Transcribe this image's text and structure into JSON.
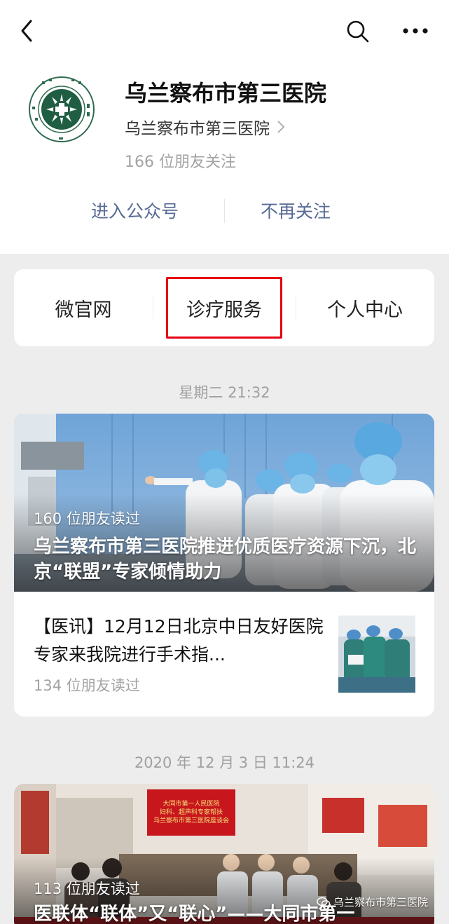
{
  "icons": {
    "back": "chevron-left-icon",
    "search": "search-icon",
    "more": "more-dots-icon",
    "chevron": "chevron-right-icon",
    "wechat": "wechat-icon"
  },
  "account": {
    "name": "乌兰察布市第三医院",
    "subject": "乌兰察布市第三医院",
    "followers": "166 位朋友关注",
    "logo_text_top": "乌兰察布市",
    "logo_text_side": "第三医院"
  },
  "actions": {
    "enter": "进入公众号",
    "unfollow": "不再关注"
  },
  "menu": {
    "items": [
      {
        "label": "微官网"
      },
      {
        "label": "诊疗服务"
      },
      {
        "label": "个人中心"
      }
    ],
    "highlighted": "诊疗服务",
    "highlight_color": "#e60012"
  },
  "colors": {
    "link": "#576b95",
    "background": "#ededed",
    "muted": "#a3a3a3"
  },
  "messages": [
    {
      "time": "星期二 21:32",
      "cover": {
        "reads": "160 位朋友读过",
        "title": "乌兰察布市第三医院推进优质医疗资源下沉，北京“联盟”专家倾情助力"
      },
      "article": {
        "title": "【医讯】12月12日北京中日友好医院专家来我院进行手术指...",
        "reads": "134 位朋友读过"
      }
    },
    {
      "time": "2020 年 12 月 3 日 11:24",
      "cover": {
        "reads": "113 位朋友读过",
        "title": "医联体“联体”又“联心”——大同市第一",
        "banner_lines": [
          "大同市第一人民医院",
          "妇科、超声科专家帮扶",
          "乌兰察布市第三医院座谈会"
        ]
      }
    }
  ],
  "watermark": "乌兰察布市第三医院"
}
